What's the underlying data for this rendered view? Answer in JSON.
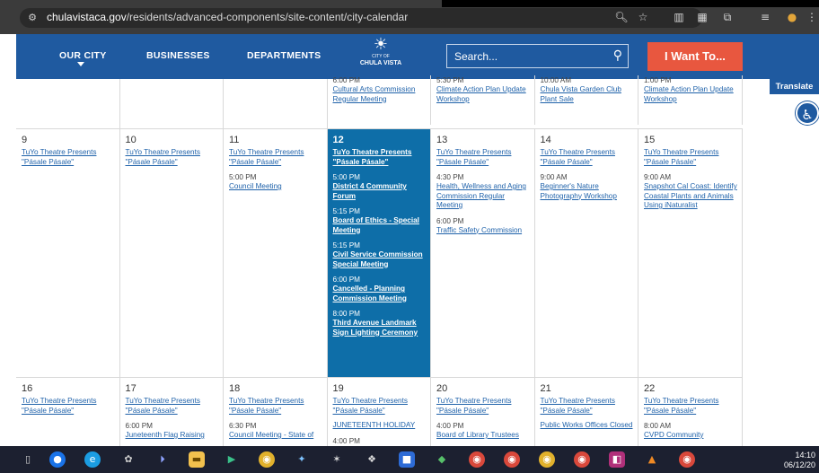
{
  "browser": {
    "url_domain": "chulavistaca.gov",
    "url_path": "/residents/advanced-components/site-content/city-calendar"
  },
  "nav": {
    "items": [
      "OUR CITY",
      "BUSINESSES",
      "DEPARTMENTS"
    ],
    "logo_small": "CITY OF",
    "logo_name": "CHULA VISTA",
    "search_placeholder": "Search...",
    "cta": "I Want To..."
  },
  "side": {
    "translate": "Translate"
  },
  "calendar": {
    "partial_row": [
      {
        "events": []
      },
      {
        "events": []
      },
      {
        "events": []
      },
      {
        "events": [
          {
            "time": "6:00 PM",
            "title": "Cultural Arts Commission Regular Meeting"
          }
        ]
      },
      {
        "events": [
          {
            "time": "5:30 PM",
            "title": "Climate Action Plan Update Workshop"
          }
        ]
      },
      {
        "events": [
          {
            "time": "10:00 AM",
            "title": "Chula Vista Garden Club Plant Sale"
          }
        ]
      },
      {
        "events": [
          {
            "time": "1:00 PM",
            "title": "Climate Action Plan Update Workshop"
          }
        ]
      }
    ],
    "week2": [
      {
        "day": "9",
        "events": [
          {
            "time": "",
            "title": "TuYo Theatre Presents \"Pásale Pásale\""
          }
        ]
      },
      {
        "day": "10",
        "events": [
          {
            "time": "",
            "title": "TuYo Theatre Presents \"Pásale Pásale\""
          }
        ]
      },
      {
        "day": "11",
        "events": [
          {
            "time": "",
            "title": "TuYo Theatre Presents \"Pásale Pásale\""
          },
          {
            "time": "5:00 PM",
            "title": "Council Meeting"
          }
        ]
      },
      {
        "day": "12",
        "today": true,
        "events": [
          {
            "time": "",
            "title": "TuYo Theatre Presents \"Pásale Pásale\""
          },
          {
            "time": "5:00 PM",
            "title": "District 4 Community Forum"
          },
          {
            "time": "5:15 PM",
            "title": "Board of Ethics - Special Meeting"
          },
          {
            "time": "5:15 PM",
            "title": "Civil Service Commission Special Meeting"
          },
          {
            "time": "6:00 PM",
            "title": "Cancelled - Planning Commission Meeting"
          },
          {
            "time": "8:00 PM",
            "title": "Third Avenue Landmark Sign Lighting Ceremony"
          }
        ]
      },
      {
        "day": "13",
        "events": [
          {
            "time": "",
            "title": "TuYo Theatre Presents \"Pásale Pásale\""
          },
          {
            "time": "4:30 PM",
            "title": "Health, Wellness and Aging Commission Regular Meeting"
          },
          {
            "time": "6:00 PM",
            "title": "Traffic Safety Commission"
          }
        ]
      },
      {
        "day": "14",
        "events": [
          {
            "time": "",
            "title": "TuYo Theatre Presents \"Pásale Pásale\""
          },
          {
            "time": "9:00 AM",
            "title": "Beginner's Nature Photography Workshop"
          }
        ]
      },
      {
        "day": "15",
        "events": [
          {
            "time": "",
            "title": "TuYo Theatre Presents \"Pásale Pásale\""
          },
          {
            "time": "9:00 AM",
            "title": "Snapshot Cal Coast: Identify Coastal Plants and Animals Using iNaturalist"
          }
        ]
      }
    ],
    "week3": [
      {
        "day": "16",
        "events": [
          {
            "time": "",
            "title": "TuYo Theatre Presents \"Pásale Pásale\""
          }
        ]
      },
      {
        "day": "17",
        "events": [
          {
            "time": "",
            "title": "TuYo Theatre Presents \"Pásale Pásale\""
          },
          {
            "time": "6:00 PM",
            "title": "Juneteenth Flag Raising"
          }
        ]
      },
      {
        "day": "18",
        "events": [
          {
            "time": "",
            "title": "TuYo Theatre Presents \"Pásale Pásale\""
          },
          {
            "time": "6:30 PM",
            "title": "Council Meeting - State of"
          }
        ]
      },
      {
        "day": "19",
        "events": [
          {
            "time": "",
            "title": "TuYo Theatre Presents \"Pásale Pásale\""
          },
          {
            "time": "",
            "title": "JUNETEENTH HOLIDAY"
          },
          {
            "time": "4:00 PM",
            "title": ""
          }
        ]
      },
      {
        "day": "20",
        "events": [
          {
            "time": "",
            "title": "TuYo Theatre Presents \"Pásale Pásale\""
          },
          {
            "time": "4:00 PM",
            "title": "Board of Library Trustees"
          }
        ]
      },
      {
        "day": "21",
        "events": [
          {
            "time": "",
            "title": "TuYo Theatre Presents \"Pásale Pásale\""
          },
          {
            "time": "",
            "title": "Public Works Offices Closed"
          }
        ]
      },
      {
        "day": "22",
        "events": [
          {
            "time": "",
            "title": "TuYo Theatre Presents \"Pásale Pásale\""
          },
          {
            "time": "8:00 AM",
            "title": "CVPD Community"
          }
        ]
      }
    ]
  },
  "taskbar": {
    "time": "14:10",
    "date": "06/12/20"
  },
  "colors": {
    "nav_blue": "#1f5aa0",
    "today_blue": "#0e6ea8",
    "cta_orange": "#e8573f",
    "link_blue": "#1f62aa"
  }
}
